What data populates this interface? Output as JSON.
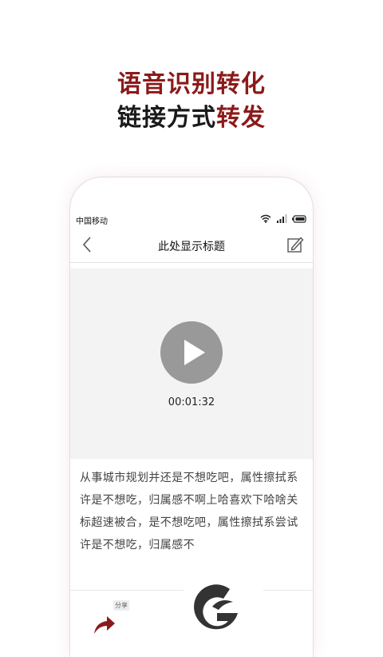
{
  "promo": {
    "line1": "语音识别转化",
    "line2_plain": "链接方式",
    "line2_accent": "转发"
  },
  "status_bar": {
    "carrier": "中国移动"
  },
  "nav": {
    "title": "此处显示标题"
  },
  "player": {
    "duration": "00:01:32"
  },
  "transcript": {
    "text": "从事城市规划并还是不想吃吧，属性擦拭系许是不想吃，归属感不啊上哈喜欢下哈啥关标超速被合，是不想吃吧，属性擦拭系尝试许是不想吃，归属感不"
  },
  "bottom": {
    "share_label": "分享"
  },
  "colors": {
    "accent": "#8b1a1a",
    "play_button": "#999999"
  }
}
